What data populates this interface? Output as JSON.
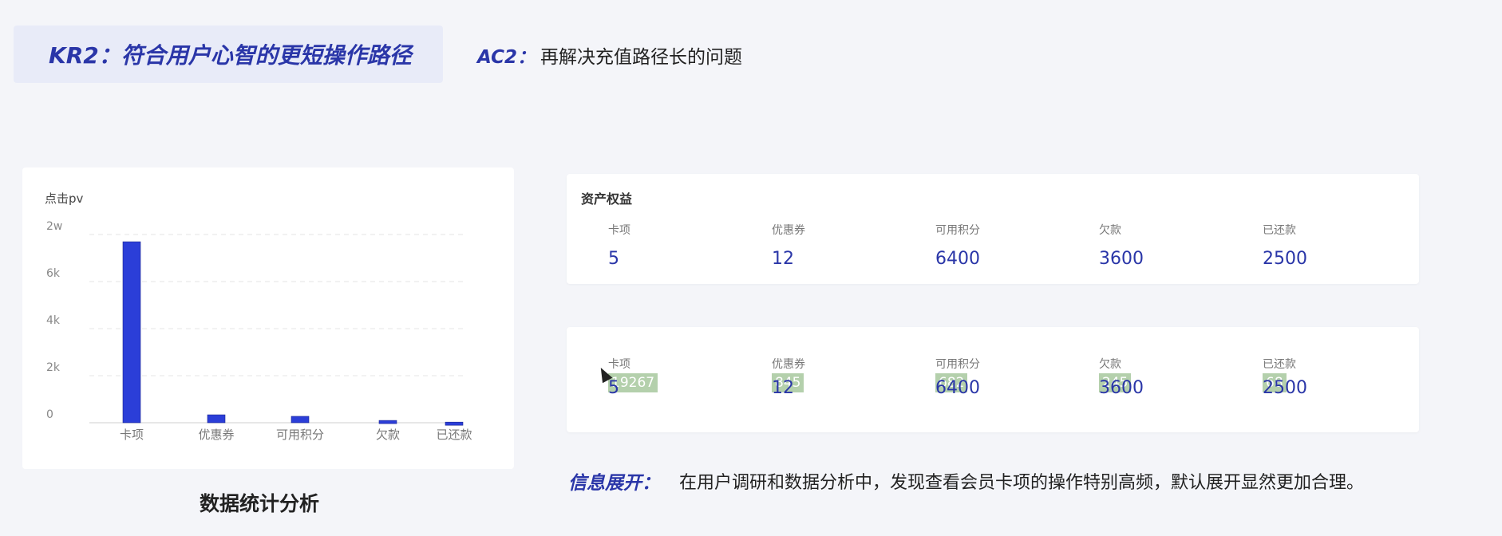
{
  "header": {
    "kr_title": "KR2：符合用户心智的更短操作路径",
    "ac_label": "AC2：",
    "ac_text": "再解决充值路径长的问题"
  },
  "chart_data": {
    "type": "bar",
    "title": "点击pv",
    "categories": [
      "卡项",
      "优惠券",
      "可用积分",
      "欠款",
      "已还款"
    ],
    "values": [
      19267,
      845,
      682,
      245,
      68
    ],
    "y_tick_labels": [
      "0",
      "2k",
      "4k",
      "6k",
      "2w"
    ],
    "bar_color": "#2b3ed8",
    "grid": true
  },
  "chart_caption": "数据统计分析",
  "asset_card": {
    "title": "资产权益",
    "items": [
      {
        "label": "卡项",
        "value": "5"
      },
      {
        "label": "优惠券",
        "value": "12"
      },
      {
        "label": "可用积分",
        "value": "6400"
      },
      {
        "label": "欠款",
        "value": "3600"
      },
      {
        "label": "已还款",
        "value": "2500"
      }
    ]
  },
  "pv_card": {
    "items": [
      {
        "label": "卡项",
        "value": "5",
        "pv": "19267"
      },
      {
        "label": "优惠券",
        "value": "12",
        "pv": "845"
      },
      {
        "label": "可用积分",
        "value": "6400",
        "pv": "682"
      },
      {
        "label": "欠款",
        "value": "3600",
        "pv": "245"
      },
      {
        "label": "已还款",
        "value": "2500",
        "pv": "68"
      }
    ]
  },
  "info": {
    "label": "信息展开：",
    "text": "在用户调研和数据分析中，发现查看会员卡项的操作特别高频，默认展开显然更加合理。"
  },
  "colors": {
    "accent": "#2a36a8",
    "badge": "#a8c89e"
  }
}
